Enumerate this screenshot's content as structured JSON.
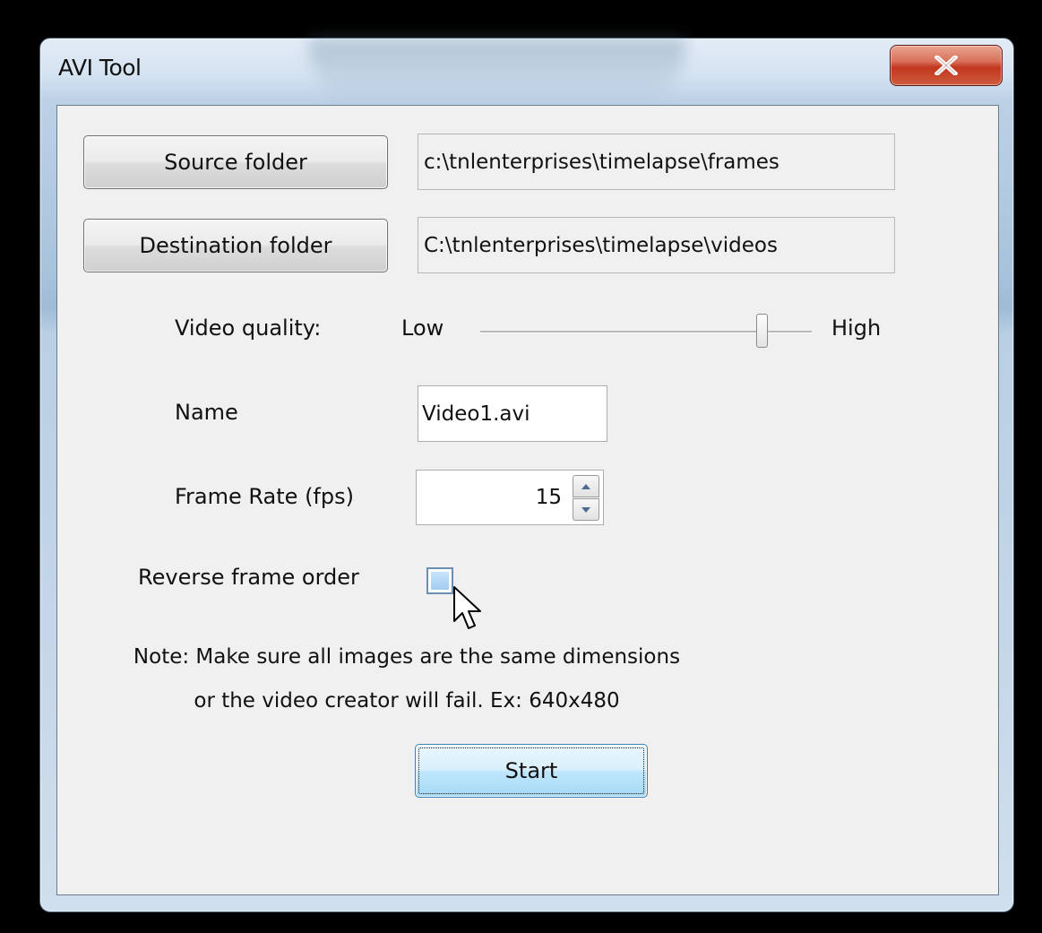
{
  "window": {
    "title": "AVI Tool"
  },
  "close_icon": "close-x-icon",
  "source": {
    "button_label": "Source folder",
    "path": "c:\\tnlenterprises\\timelapse\\frames"
  },
  "destination": {
    "button_label": "Destination folder",
    "path": "C:\\tnlenterprises\\timelapse\\videos"
  },
  "quality": {
    "label": "Video quality:",
    "low_label": "Low",
    "high_label": "High",
    "level": 0.85
  },
  "name": {
    "label": "Name",
    "value": "Video1.avi"
  },
  "frame_rate": {
    "label": "Frame Rate (fps)",
    "value": "15"
  },
  "reverse": {
    "label": "Reverse frame order",
    "checked": false
  },
  "note": {
    "line1": "Note: Make sure all images are the same dimensions",
    "line2": "or the video creator will fail. Ex: 640x480"
  },
  "start_button": {
    "label": "Start"
  },
  "colors": {
    "close_button": "#c2381f",
    "focus_button": "#bee6fd",
    "client_background": "#f0f0f0"
  }
}
